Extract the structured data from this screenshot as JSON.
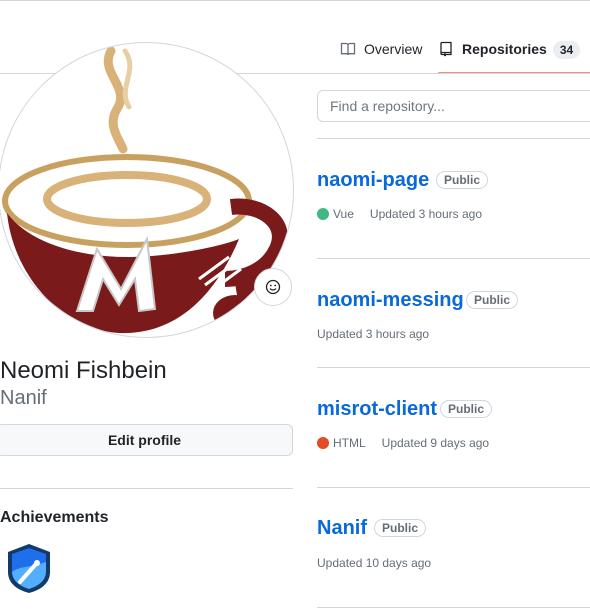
{
  "tabs": {
    "overview_label": "Overview",
    "repositories_label": "Repositories",
    "repositories_count": "34"
  },
  "profile": {
    "name": "Neomi Fishbein",
    "login": "Nanif",
    "edit_label": "Edit profile"
  },
  "achievements": {
    "title": "Achievements"
  },
  "search": {
    "placeholder": "Find a repository..."
  },
  "repos": [
    {
      "name": "naomi-page",
      "visibility": "Public",
      "language": "Vue",
      "language_color": "#41b883",
      "updated": "Updated 3 hours ago"
    },
    {
      "name": "naomi-messing",
      "visibility": "Public",
      "language": "",
      "language_color": "",
      "updated": "Updated 3 hours ago"
    },
    {
      "name": "misrot-client",
      "visibility": "Public",
      "language": "HTML",
      "language_color": "#e34c26",
      "updated": "Updated 9 days ago"
    },
    {
      "name": "Nanif",
      "visibility": "Public",
      "language": "",
      "language_color": "",
      "updated": "Updated 10 days ago"
    }
  ],
  "colors": {
    "accent": "#0969da",
    "tab_underline": "#fd8c73",
    "logo_maroon": "#7a1a1a",
    "logo_tan": "#c8a060"
  }
}
